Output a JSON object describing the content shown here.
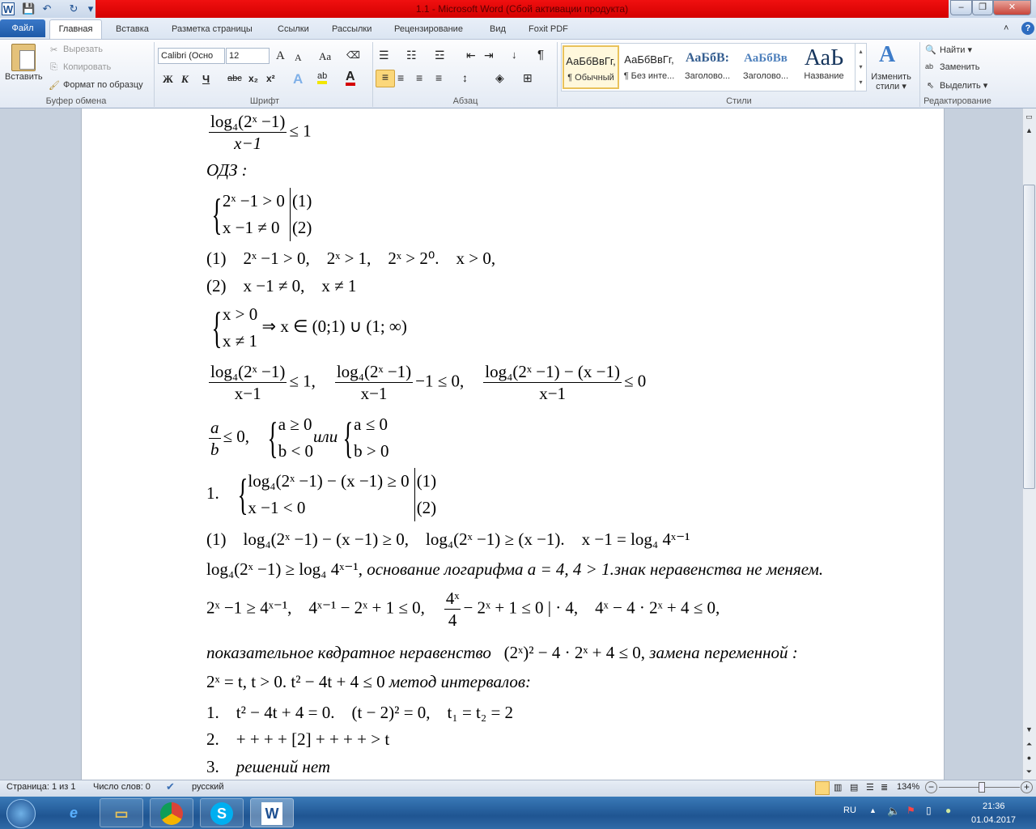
{
  "window": {
    "title": "1.1  -  Microsoft Word (Сбой активации продукта)",
    "minimize": "–",
    "maximize": "❐",
    "close": "✕"
  },
  "qat": {
    "word": "W",
    "save": "💾",
    "undo": "↶",
    "redo": "↻",
    "customize": "▾"
  },
  "tabs": [
    "Файл",
    "Главная",
    "Вставка",
    "Разметка страницы",
    "Ссылки",
    "Рассылки",
    "Рецензирование",
    "Вид",
    "Foxit PDF"
  ],
  "clipboard": {
    "paste": "Вставить",
    "cut": "Вырезать",
    "copy": "Копировать",
    "format_painter": "Формат по образцу",
    "label": "Буфер обмена"
  },
  "font": {
    "name": "Calibri (Осно",
    "size": "12",
    "grow": "A",
    "shrink": "A",
    "case": "Aa",
    "bold": "Ж",
    "italic": "К",
    "underline": "Ч",
    "strike": "abc",
    "sub": "x₂",
    "sup": "x²",
    "effects": "A",
    "highlight": "ab",
    "color": "A",
    "label": "Шрифт"
  },
  "paragraph": {
    "label": "Абзац",
    "pilcrow": "¶"
  },
  "styles": {
    "items": [
      {
        "preview": "АаБбВвГг,",
        "name": "¶ Обычный"
      },
      {
        "preview": "АаБбВвГг,",
        "name": "¶ Без инте..."
      },
      {
        "preview": "АаБбВ:",
        "name": "Заголово..."
      },
      {
        "preview": "АаБбВв",
        "name": "Заголово..."
      },
      {
        "preview": "АаЬ",
        "name": "Название"
      }
    ],
    "change": "Изменить стили ▾",
    "label": "Стили"
  },
  "editing": {
    "find": "Найти ▾",
    "replace": "Заменить",
    "select": "Выделить ▾",
    "label": "Редактирование"
  },
  "doc": {
    "l1": {
      "num": "log₄(2ˣ −1)",
      "den": "x−1",
      "rest": "≤ 1"
    },
    "l2": "ОДЗ :",
    "l3": {
      "r1": "2ˣ −1 > 0",
      "r2": "x −1 ≠ 0",
      "t1": "(1)",
      "t2": "(2)"
    },
    "l4": "(1)    2ˣ −1 > 0,    2ˣ > 1,    2ˣ > 2⁰.    x > 0,",
    "l5": "(2)    x −1 ≠ 0,    x ≠ 1",
    "l6": {
      "r1": "x > 0",
      "r2": "x ≠ 1",
      "rest": "⇒ x ∈ (0;1) ∪ (1; ∞)"
    },
    "l7": {
      "f1n": "log₄(2ˣ −1)",
      "f1d": "x−1",
      "a": "≤ 1,",
      "f2n": "log₄(2ˣ −1)",
      "f2d": "x−1",
      "b": "−1 ≤ 0,",
      "f3n": "log₄(2ˣ −1) − (x −1)",
      "f3d": "x−1",
      "c": "≤ 0"
    },
    "l8": {
      "fn": "a",
      "fd": "b",
      "a": "≤ 0,",
      "s1r1": "a ≥ 0",
      "s1r2": "b < 0",
      "or": "или",
      "s2r1": "a ≤ 0",
      "s2r2": "b > 0"
    },
    "l9": {
      "num": "1.",
      "r1": "log₄(2ˣ −1) − (x −1) ≥ 0",
      "r2": "x −1 < 0",
      "t1": "(1)",
      "t2": "(2)"
    },
    "l10": "(1)    log₄(2ˣ −1) − (x −1) ≥ 0,    log₄(2ˣ −1) ≥ (x −1).    x −1 = log₄ 4ˣ⁻¹",
    "l11a": "log₄(2ˣ −1) ≥ log₄ 4ˣ⁻¹, ",
    "l11b": "основание логарифма a = 4, 4 > 1.знак неравенства не меняем.",
    "l12": {
      "a": "2ˣ −1 ≥ 4ˣ⁻¹,    4ˣ⁻¹ − 2ˣ + 1 ≤ 0,",
      "fn": "4ˣ",
      "fd": "4",
      "b": "− 2ˣ + 1 ≤ 0 | · 4,    4ˣ − 4 · 2ˣ + 4 ≤ 0,"
    },
    "l13a": "показательное квдратное неравенство",
    "l13b": "   (2ˣ)² − 4 · 2ˣ + 4 ≤ 0, ",
    "l13c": "замена переменной :",
    "l14a": "2ˣ = t, t > 0. t² − 4t + 4 ≤ 0 ",
    "l14b": "метод интервалов:",
    "l15": "1.    t² − 4t + 4 = 0.    (t − 2)² = 0,    t₁ = t₂ = 2",
    "l16": "2.    + + + + [2] + + + + > t",
    "l17a": "3.    ",
    "l17b": "решений нет"
  },
  "status": {
    "page": "Страница: 1 из 1",
    "words": "Число слов: 0",
    "lang": "русский",
    "zoom": "134%"
  },
  "taskbar": {
    "lang": "RU",
    "time": "21:36",
    "date": "01.04.2017"
  }
}
